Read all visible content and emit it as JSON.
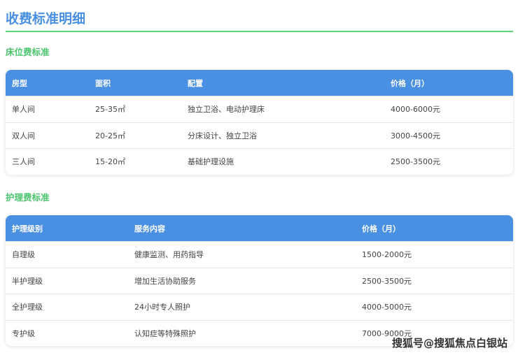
{
  "title": "收费标准明细",
  "bed": {
    "heading": "床位费标准",
    "columns": [
      "房型",
      "面积",
      "配置",
      "价格（月）"
    ],
    "rows": [
      [
        "单人间",
        "25-35㎡",
        "独立卫浴、电动护理床",
        "4000-6000元"
      ],
      [
        "双人间",
        "20-25㎡",
        "分床设计、独立卫浴",
        "3000-4500元"
      ],
      [
        "三人间",
        "15-20㎡",
        "基础护理设施",
        "2500-3500元"
      ]
    ]
  },
  "care": {
    "heading": "护理费标准",
    "columns": [
      "护理级别",
      "服务内容",
      "价格（月）"
    ],
    "rows": [
      [
        "自理级",
        "健康监测、用药指导",
        "1500-2000元"
      ],
      [
        "半护理级",
        "增加生活协助服务",
        "2500-3500元"
      ],
      [
        "全护理级",
        "24小时专人照护",
        "4000-5000元"
      ],
      [
        "专护级",
        "认知症等特殊照护",
        "7000-9000元"
      ]
    ]
  },
  "watermark": "搜狐号@搜狐焦点白银站"
}
